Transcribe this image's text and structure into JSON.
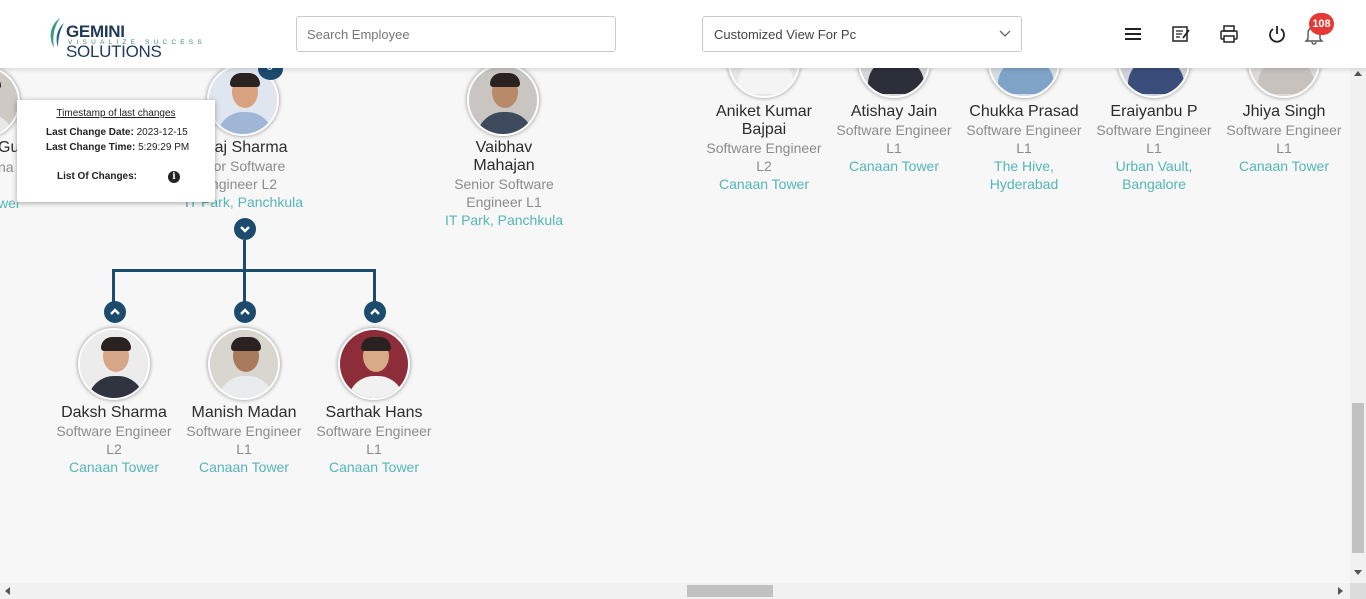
{
  "header": {
    "logo": {
      "brand": "GEMINI",
      "brand2": "SOLUTIONS",
      "tagline": "VISUALIZE SUCCESS"
    },
    "search": {
      "placeholder": "Search Employee"
    },
    "view": {
      "selected": "Customized View For Pc"
    },
    "icons": [
      "menu-icon",
      "notes-icon",
      "print-icon",
      "power-icon",
      "bell-icon"
    ],
    "notifications": {
      "count": "108"
    }
  },
  "tooltip": {
    "title": "Timestamp of last changes",
    "date_label": "Last Change Date:",
    "date_value": "2023-12-15",
    "time_label": "Last Change Time:",
    "time_value": "5:29:29 PM",
    "changes_label": "List Of Changes:",
    "info_glyph": "i"
  },
  "colors": {
    "accent": "#1c4b6e",
    "location": "#54b5b7",
    "badge": "#e53935"
  },
  "partial_left": {
    "name": "Gu",
    "title_fragment": "na",
    "loc_fragment": "wer"
  },
  "nodes": {
    "neeraj": {
      "name": "eraj Sharma",
      "title1": "nior Software",
      "title2": "ngineer L2",
      "loc": "IT Park, Panchkula",
      "badge_fragment": "8"
    },
    "vaibhav": {
      "name1": "Vaibhav",
      "name2": "Mahajan",
      "title1": "Senior Software",
      "title2": "Engineer L1",
      "loc": "IT Park, Panchkula"
    },
    "aniket": {
      "name1": "Aniket Kumar",
      "name2": "Bajpai",
      "title1": "Software Engineer",
      "title2": "L2",
      "loc": "Canaan Tower"
    },
    "atishay": {
      "name": "Atishay Jain",
      "title1": "Software Engineer",
      "title2": "L1",
      "loc": "Canaan Tower"
    },
    "chukka": {
      "name": "Chukka Prasad",
      "title1": "Software Engineer",
      "title2": "L1",
      "loc1": "The Hive,",
      "loc2": "Hyderabad"
    },
    "eraiyanbu": {
      "name": "Eraiyanbu P",
      "title1": "Software Engineer",
      "title2": "L1",
      "loc1": "Urban Vault,",
      "loc2": "Bangalore"
    },
    "jhiya": {
      "name": "Jhiya Singh",
      "title1": "Software Engineer",
      "title2": "L1",
      "loc": "Canaan Tower"
    },
    "daksh": {
      "name": "Daksh Sharma",
      "title1": "Software Engineer",
      "title2": "L2",
      "loc": "Canaan Tower"
    },
    "manish": {
      "name": "Manish Madan",
      "title1": "Software Engineer",
      "title2": "L1",
      "loc": "Canaan Tower"
    },
    "sarthak": {
      "name": "Sarthak Hans",
      "title1": "Software Engineer",
      "title2": "L1",
      "loc": "Canaan Tower"
    }
  }
}
